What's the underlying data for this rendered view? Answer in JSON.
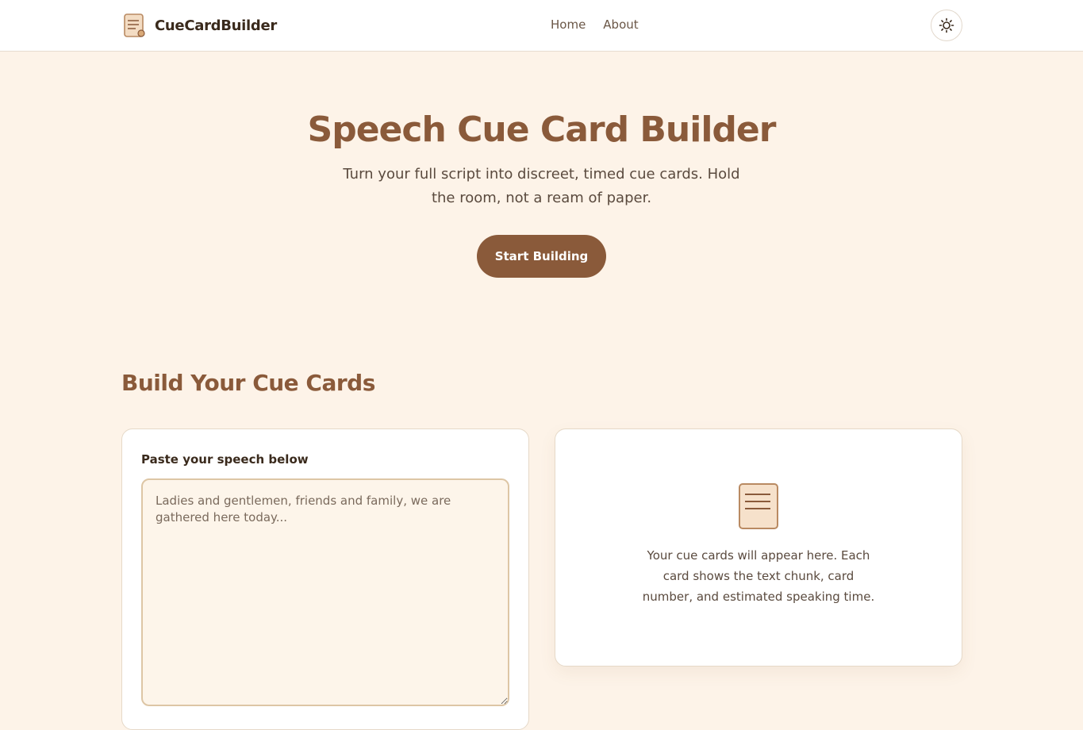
{
  "nav": {
    "brand": "CueCardBuilder",
    "links": [
      "Home",
      "About"
    ]
  },
  "hero": {
    "title": "Speech Cue Card Builder",
    "subtitle": "Turn your full script into discreet, timed cue cards. Hold the room, not a ream of paper.",
    "cta": "Start Building"
  },
  "builder": {
    "title": "Build Your Cue Cards",
    "input_label": "Paste your speech below",
    "input_placeholder": "Ladies and gentlemen, friends and family, we are gathered here today...",
    "input_value": "",
    "empty_state": "Your cue cards will appear here. Each card shows the text chunk, card number, and estimated speaking time."
  },
  "icons": {
    "logo": "document-icon",
    "theme": "sun-icon",
    "empty": "document-icon"
  },
  "colors": {
    "accent": "#8a5a3a",
    "background": "#fdf3e8",
    "input_border": "#ddc6a5"
  }
}
